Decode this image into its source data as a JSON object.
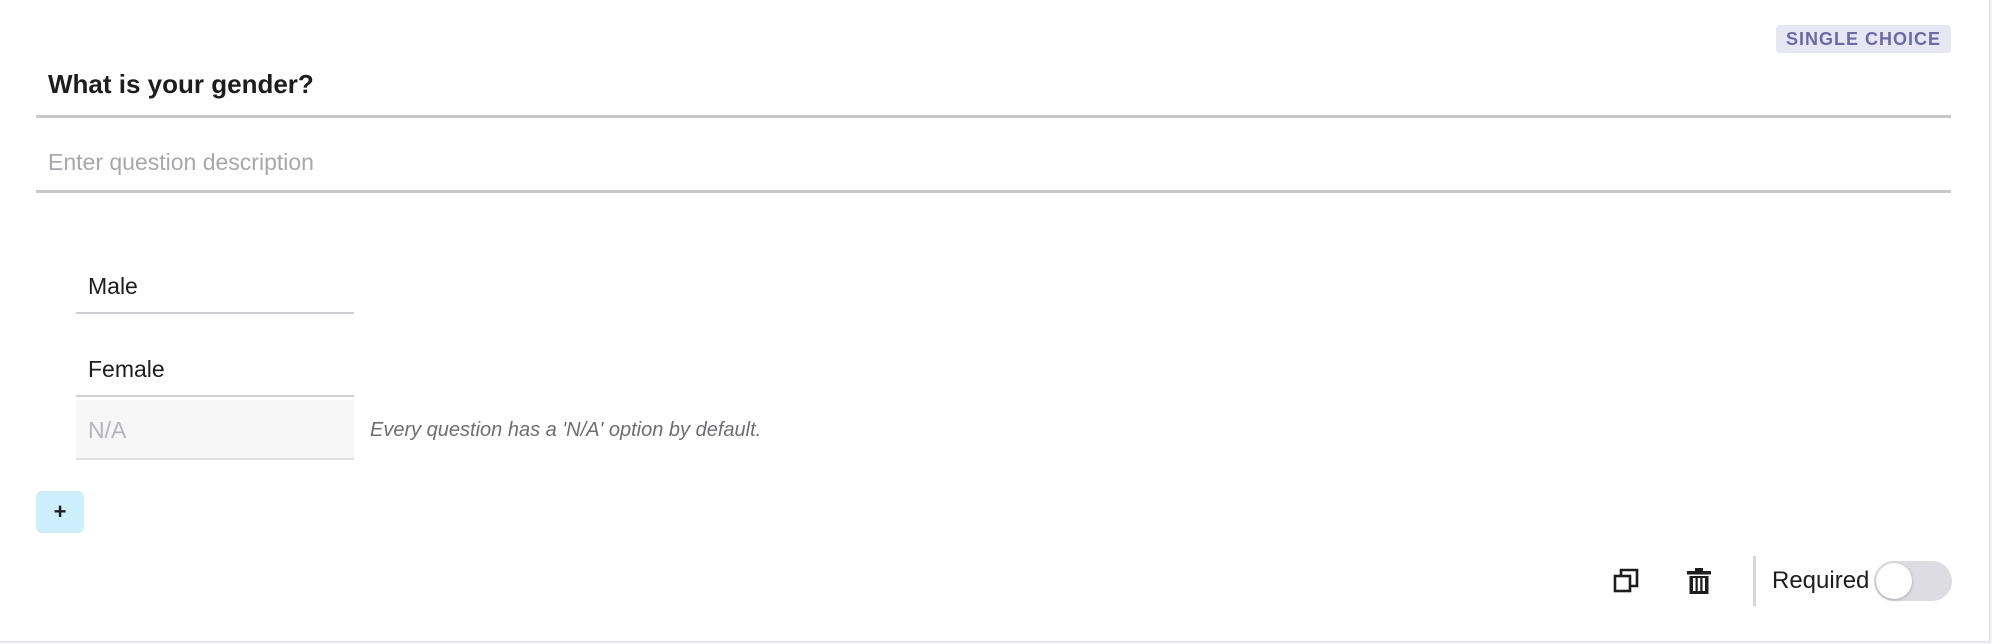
{
  "question": {
    "type_badge": "SINGLE CHOICE",
    "title": "What is your gender?",
    "description_value": "",
    "description_placeholder": "Enter question description"
  },
  "options": [
    {
      "label": "Male"
    },
    {
      "label": "Female"
    }
  ],
  "na_option": {
    "label": "N/A",
    "hint": "Every question has a 'N/A' option by default."
  },
  "add_button": {
    "label": "+"
  },
  "footer": {
    "duplicate_icon": "duplicate-icon",
    "delete_icon": "trash-icon",
    "required_label": "Required",
    "required_enabled": false
  },
  "colors": {
    "badge_bg": "#e7e6f3",
    "badge_text": "#6b6aa6",
    "add_button_bg": "#cdeefc",
    "toggle_off": "#dcdce2"
  }
}
